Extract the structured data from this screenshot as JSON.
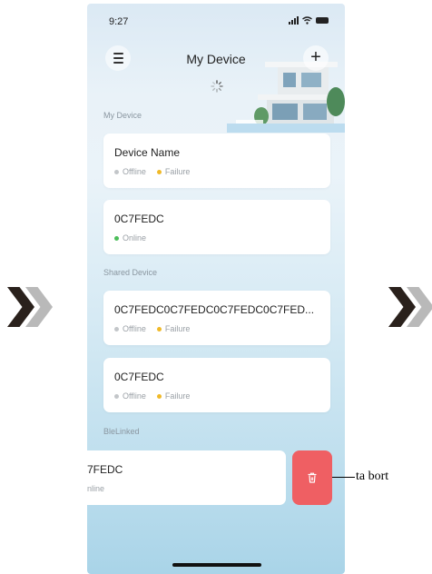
{
  "status_bar": {
    "time": "9:27"
  },
  "header": {
    "title": "My Device"
  },
  "sections": {
    "my_device": "My Device",
    "shared_device": "Shared Device",
    "ble_linked": "BleLinked"
  },
  "devices": [
    {
      "name": "Device Name",
      "status": "Offline",
      "alert": "Failure"
    },
    {
      "name": "0C7FEDC",
      "status": "Online"
    },
    {
      "name": "0C7FEDC0C7FEDC0C7FEDC0C7FED...",
      "status": "Offline",
      "alert": "Failure"
    },
    {
      "name": "0C7FEDC",
      "status": "Offline",
      "alert": "Failure"
    }
  ],
  "swiped_device": {
    "name": "7FEDC",
    "status": "nline"
  },
  "callout": {
    "label": "ta bort"
  },
  "icons": {
    "menu": "menu-icon",
    "add": "plus-icon",
    "spinner": "loading-spinner-icon",
    "delete": "trash-icon",
    "chevrons": "double-chevron-right-icon"
  },
  "colors": {
    "delete": "#ef5f63",
    "online": "#4cbe5a",
    "failure": "#f0b928",
    "offline": "#c3c6c9"
  }
}
